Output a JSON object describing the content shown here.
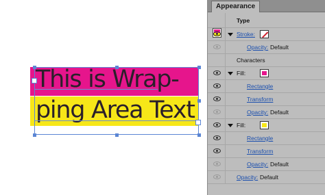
{
  "canvas": {
    "line1": "This is Wrap-",
    "line2": "ping Area Text"
  },
  "panel": {
    "tab_label": "Appearance",
    "type_label": "Type",
    "rows": {
      "stroke": "Stroke:",
      "stroke_opacity_label": "Opacity:",
      "stroke_opacity_value": "Default",
      "characters": "Characters",
      "fill1": "Fill:",
      "rectangle1": "Rectangle",
      "transform1": "Transform",
      "fill1_opacity_label": "Opacity:",
      "fill1_opacity_value": "Default",
      "fill2": "Fill:",
      "rectangle2": "Rectangle",
      "transform2": "Transform",
      "fill2_opacity_label": "Opacity:",
      "fill2_opacity_value": "Default",
      "opacity_label": "Opacity:",
      "opacity_value": "Default"
    }
  },
  "colors": {
    "magenta": "#e6158c",
    "yellow": "#f7e718",
    "selection_blue": "#5b86d4",
    "link_blue": "#1b4fae"
  },
  "icons": [
    "eye-icon",
    "disclosure-triangle-icon",
    "fill-swatch-icon",
    "stroke-swatch-icon"
  ]
}
